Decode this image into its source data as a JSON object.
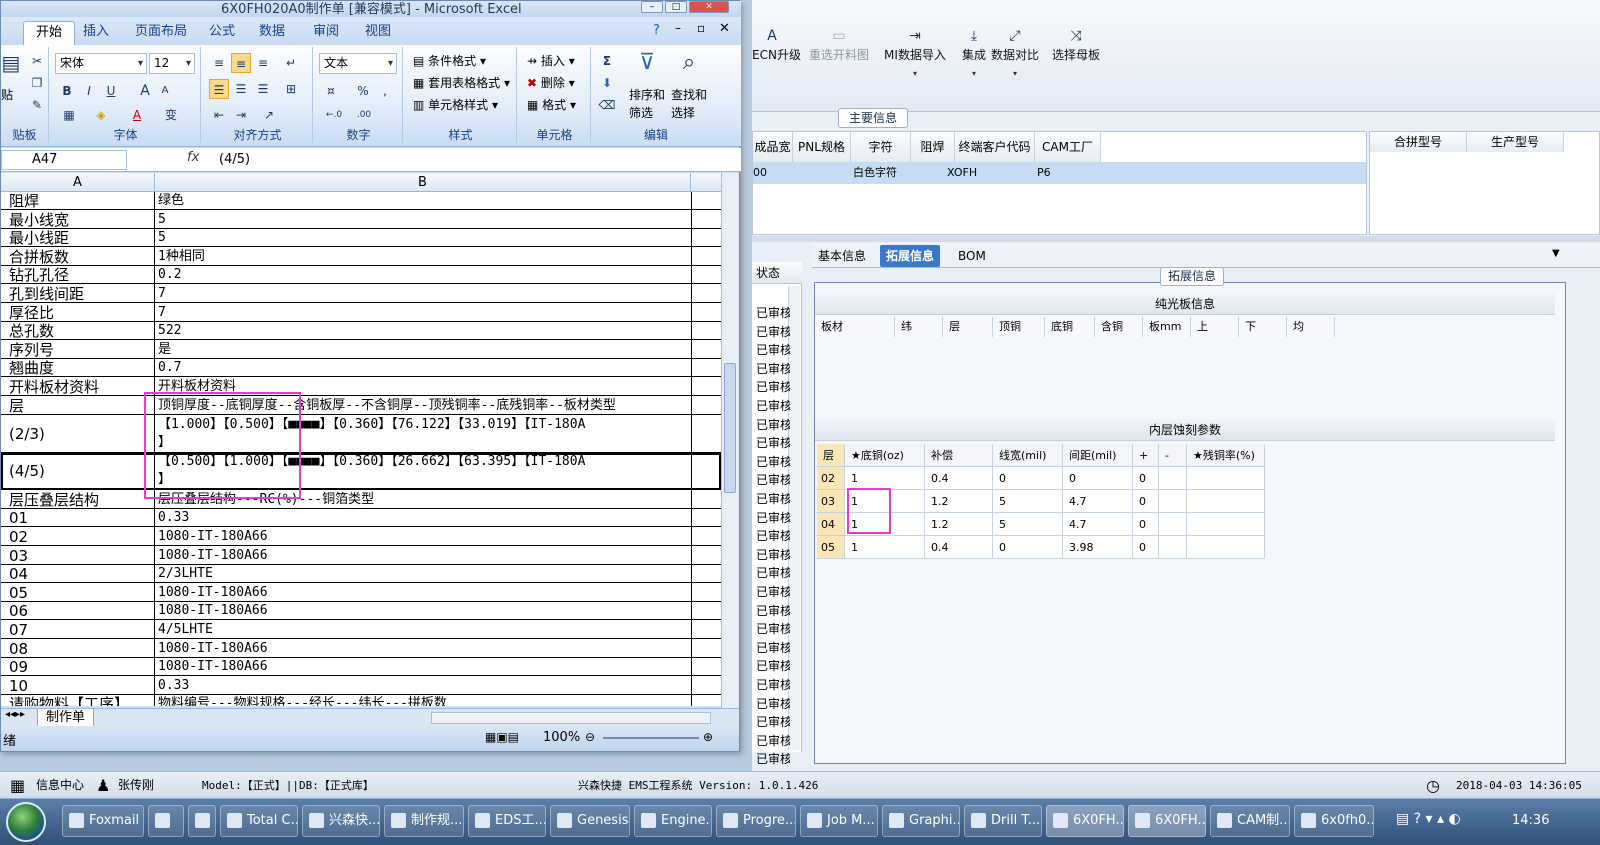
{
  "excel": {
    "title": "6X0FH020A0制作单 [兼容模式] - Microsoft Excel",
    "ribbon_tabs": [
      "开始",
      "插入",
      "页面布局",
      "公式",
      "数据",
      "审阅",
      "视图"
    ],
    "clipboard": {
      "paste": "贴",
      "label": "贴板"
    },
    "font": {
      "name": "宋体",
      "size": "12",
      "bold": "B",
      "italic": "I",
      "underline": "U",
      "grow": "A",
      "shrink": "A",
      "wen": "变",
      "font_color": "A",
      "label": "字体"
    },
    "align_label": "对齐方式",
    "number": {
      "format": "文本",
      "percent": "%",
      "comma": ",",
      "inc": "←.0",
      "dec": ".00",
      "label": "数字"
    },
    "styles": {
      "cond": "条件格式",
      "table": "套用表格格式",
      "cell": "单元格样式",
      "label": "样式"
    },
    "cells": {
      "insert": "插入",
      "delete": "删除",
      "format": "格式",
      "label": "单元格"
    },
    "edit": {
      "sum": "Σ",
      "sort": "排序和",
      "filter": "筛选",
      "find": "查找和",
      "select": "选择",
      "label": "编辑"
    },
    "namebox": "A47",
    "formula_label": "fx",
    "formula": "(4/5)",
    "col_a": "A",
    "col_b": "B",
    "rows": [
      {
        "a": "阻焊",
        "b": "绿色"
      },
      {
        "a": "最小线宽",
        "b": "5"
      },
      {
        "a": "最小线距",
        "b": "5"
      },
      {
        "a": "合拼板数",
        "b": "1种相同"
      },
      {
        "a": "钻孔孔径",
        "b": "0.2"
      },
      {
        "a": "孔到线间距",
        "b": "7"
      },
      {
        "a": "厚径比",
        "b": "7"
      },
      {
        "a": "总孔数",
        "b": "522"
      },
      {
        "a": "序列号",
        "b": "是"
      },
      {
        "a": "翘曲度",
        "b": "0.7"
      },
      {
        "a": "开料板材资料",
        "b": "开料板材资料"
      },
      {
        "a": "层",
        "b": "顶铜厚度--底铜厚度--含铜板厚--不含铜厚--顶残铜率--底残铜率--板材类型"
      },
      {
        "a": "(2/3)",
        "b": "【1.000】【0.500】【■■■■】【0.360】【76.122】【33.019】【IT-180A",
        "b2": "】"
      },
      {
        "a": "(4/5)",
        "b": "【0.500】【1.000】【■■■■】【0.360】【26.662】【63.395】【IT-180A",
        "b2": "】"
      },
      {
        "a": "层压叠层结构",
        "b": "层压叠层结构---RC(%)---铜箔类型"
      },
      {
        "a": "01",
        "b": "0.33"
      },
      {
        "a": "02",
        "b": "1080-IT-180A66"
      },
      {
        "a": "03",
        "b": "1080-IT-180A66"
      },
      {
        "a": "04",
        "b": "2/3LHTE"
      },
      {
        "a": "05",
        "b": "1080-IT-180A66"
      },
      {
        "a": "06",
        "b": "1080-IT-180A66"
      },
      {
        "a": "07",
        "b": "4/5LHTE"
      },
      {
        "a": "08",
        "b": "1080-IT-180A66"
      },
      {
        "a": "09",
        "b": "1080-IT-180A66"
      },
      {
        "a": "10",
        "b": "0.33"
      },
      {
        "a": "请购物料【工序】",
        "b": "物料编号---物料规格---经长---纬长---拼板数"
      }
    ],
    "sheet_tab": "制作单",
    "status_left": "绪",
    "zoom": "100%"
  },
  "ems": {
    "toolbar": [
      {
        "label": "ECN升级",
        "icon": "A",
        "disabled": false,
        "dropdown": ""
      },
      {
        "label": "重选开料图",
        "icon": "▭",
        "disabled": true,
        "dropdown": ""
      },
      {
        "label": "MI数据导入",
        "icon": "⇥",
        "disabled": false,
        "dropdown": "▾"
      },
      {
        "label": "集成",
        "icon": "⤓",
        "disabled": false,
        "dropdown": "▾"
      },
      {
        "label": "数据对比",
        "icon": "⤢",
        "disabled": false,
        "dropdown": "▾"
      },
      {
        "label": "选择母板",
        "icon": "⤨",
        "disabled": false,
        "dropdown": ""
      }
    ],
    "main_info_label": "主要信息",
    "grid1_headers": [
      "成品宽度",
      "PNL规格",
      "字符",
      "阻焊",
      "终端客户代码",
      "CAM工厂"
    ],
    "grid1_row": [
      "00",
      "",
      "白色字符",
      "XOFH",
      "P6",
      ""
    ],
    "grid2_headers": [
      "合拼型号",
      "生产型号"
    ],
    "tabs": [
      "基本信息",
      "拓展信息",
      "BOM"
    ],
    "state_header": "状态",
    "state_value": "已审核",
    "ext_label": "拓展信息",
    "board_title": "纯光板信息",
    "board_headers": [
      "板材",
      "纬",
      "层",
      "顶铜",
      "底铜",
      "含铜",
      "板mm",
      "上",
      "下",
      "均"
    ],
    "etch_title": "内层蚀刻参数",
    "etch_headers": [
      "层",
      "★底铜(oz)",
      "补偿",
      "线宽(mil)",
      "间距(mil)",
      "+",
      "-",
      "★残铜率(%)"
    ],
    "etch_rows": [
      [
        "02",
        "1",
        "0.4",
        "0",
        "0",
        "0",
        "",
        ""
      ],
      [
        "03",
        "1",
        "1.2",
        "5",
        "4.7",
        "0",
        "",
        ""
      ],
      [
        "04",
        "1",
        "1.2",
        "5",
        "4.7",
        "0",
        "",
        ""
      ],
      [
        "05",
        "1",
        "0.4",
        "0",
        "3.98",
        "0",
        "",
        ""
      ]
    ]
  },
  "status": {
    "info_center": "信息中心",
    "user": "张传刚",
    "model": "Model:【正式】||DB:【正式库】",
    "system": "兴森快捷 EMS工程系统 Version: 1.0.1.426",
    "datetime": "2018-04-03 14:36:05"
  },
  "taskbar": {
    "items": [
      "Foxmail",
      "",
      "",
      "Total C...",
      "兴森快...",
      "制作规...",
      "EDS工...",
      "Genesis",
      "Engine...",
      "Progre...",
      "Job M...",
      "Graphi...",
      "Drill T...",
      "6X0FH...",
      "6X0FH...",
      "CAM制...",
      "6x0fh0..."
    ],
    "clock": "14:36"
  }
}
